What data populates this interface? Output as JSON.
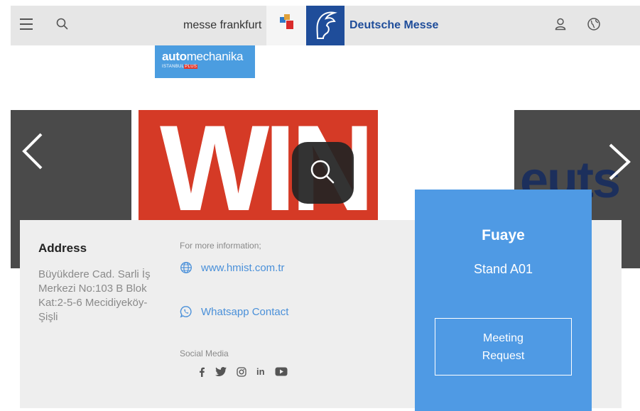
{
  "header": {
    "brand_left": "messe frankfurt",
    "brand_right": "Deutsche Messe",
    "icons": [
      "menu-icon",
      "search-icon",
      "user-icon",
      "globe-icon"
    ]
  },
  "event_logo": {
    "name_bold": "auto",
    "name_rest": "mechanika",
    "sub_text": "ISTANBUL",
    "sub_badge": "PLUS"
  },
  "carousel": {
    "main_slide_text": "WIN",
    "right_slide_text": "euts",
    "icons": [
      "chevron-left-icon",
      "chevron-right-icon",
      "zoom-icon"
    ]
  },
  "address": {
    "title": "Address",
    "lines": [
      "Büyükdere Cad. Sarli İş",
      "Merkezi No:103 B Blok",
      "Kat:2-5-6 Mecidiyeköy-",
      "Şişli"
    ]
  },
  "contact": {
    "more_info_label": "For more information;",
    "website": "www.hmist.com.tr",
    "whatsapp": "Whatsapp Contact",
    "social_label": "Social Media",
    "social_icons": [
      "facebook-icon",
      "twitter-icon",
      "instagram-icon",
      "linkedin-icon",
      "youtube-icon"
    ]
  },
  "stand": {
    "hall": "Fuaye",
    "stand_no": "Stand A01",
    "meeting_line1": "Meeting",
    "meeting_line2": "Request"
  },
  "colors": {
    "accent_blue": "#4f9ae4",
    "link_blue": "#4a90d9",
    "deutsche_messe_blue": "#1f4d9a",
    "slide_red": "#d53a26",
    "header_gray": "#e6e6e6",
    "card_gray": "#eeeeee"
  }
}
